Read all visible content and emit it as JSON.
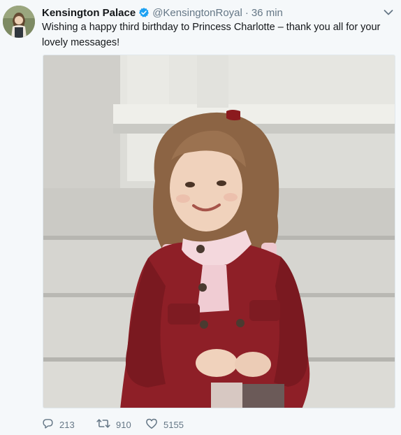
{
  "tweet": {
    "author_name": "Kensington Palace",
    "verified_icon": "verified-badge-icon",
    "handle": "@KensingtonRoyal",
    "separator": "·",
    "time": "36 min",
    "text": "Wishing a happy third birthday to Princess Charlotte – thank you all for your lovely messages!",
    "media_description": "photo"
  },
  "actions": {
    "reply_icon": "reply-icon",
    "reply_count": "213",
    "retweet_icon": "retweet-icon",
    "retweet_count": "910",
    "like_icon": "heart-icon",
    "like_count": "5155"
  },
  "colors": {
    "background": "#f5f8fa",
    "verified_blue": "#1da1f2",
    "secondary_text": "#657786"
  }
}
